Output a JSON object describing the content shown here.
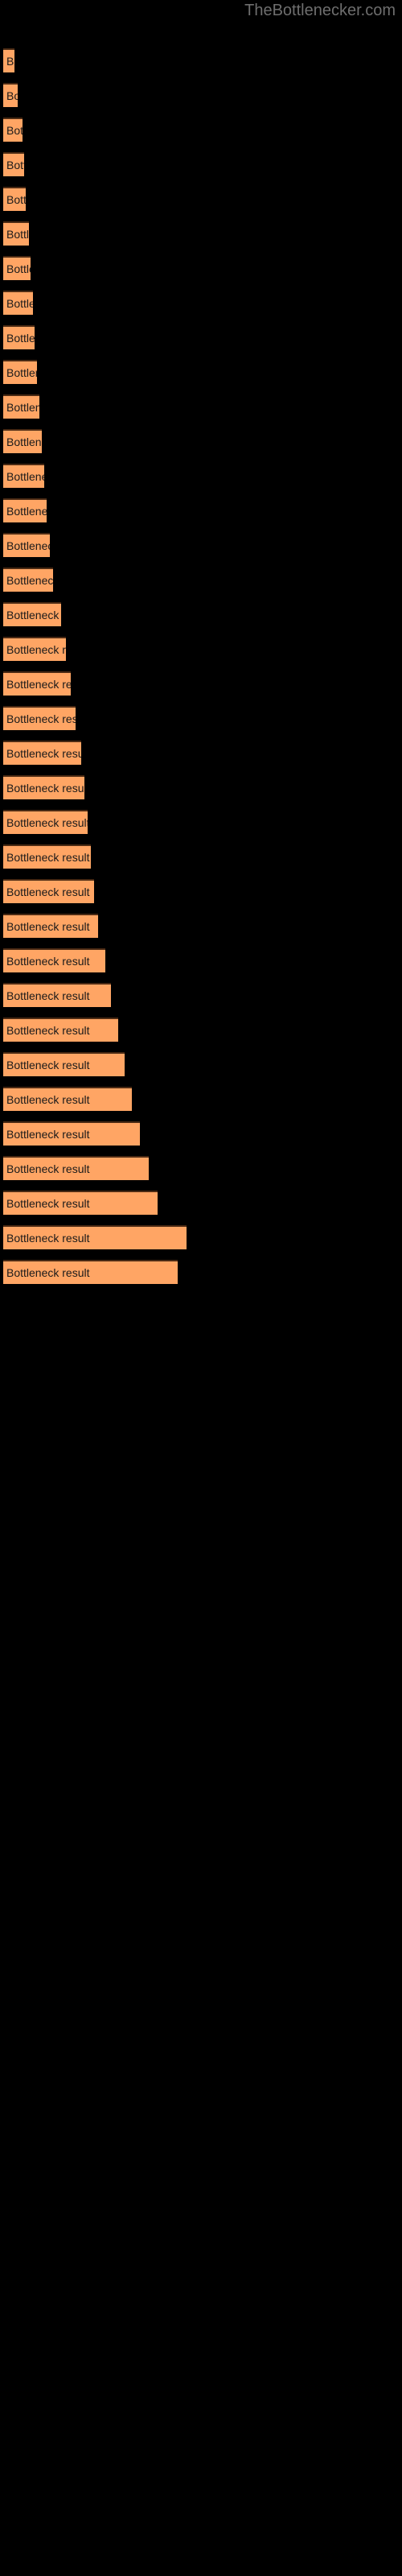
{
  "watermark": {
    "text": "TheBottlenecker.com",
    "color": "#6e6e6e"
  },
  "colors": {
    "background": "#000000",
    "bar_fill": "#ffa564",
    "bar_border_top": "#4a2a14",
    "label_text": "#1a1a1a",
    "watermark_text": "#6e6e6e"
  },
  "chart_data": {
    "type": "bar",
    "orientation": "horizontal",
    "title": "",
    "subtitle": "",
    "xlabel": "",
    "ylabel": "",
    "grid": false,
    "legend": null,
    "axis_visible": false,
    "tick_labels": [],
    "xlim": [
      0,
      228
    ],
    "bar_label_text": "Bottleneck result",
    "categories": [
      "Bottleneck result",
      "Bottleneck result",
      "Bottleneck result",
      "Bottleneck result",
      "Bottleneck result",
      "Bottleneck result",
      "Bottleneck result",
      "Bottleneck result",
      "Bottleneck result",
      "Bottleneck result",
      "Bottleneck result",
      "Bottleneck result",
      "Bottleneck result",
      "Bottleneck result",
      "Bottleneck result",
      "Bottleneck result",
      "Bottleneck result",
      "Bottleneck result",
      "Bottleneck result",
      "Bottleneck result",
      "Bottleneck result",
      "Bottleneck result",
      "Bottleneck result",
      "Bottleneck result",
      "Bottleneck result",
      "Bottleneck result",
      "Bottleneck result",
      "Bottleneck result",
      "Bottleneck result",
      "Bottleneck result",
      "Bottleneck result",
      "Bottleneck result",
      "Bottleneck result",
      "Bottleneck result",
      "Bottleneck result",
      "Bottleneck result"
    ],
    "values": [
      14,
      18,
      24,
      26,
      28,
      32,
      34,
      37,
      39,
      42,
      45,
      48,
      51,
      54,
      58,
      62,
      72,
      78,
      84,
      90,
      97,
      101,
      105,
      109,
      113,
      118,
      127,
      134,
      143,
      151,
      160,
      170,
      181,
      192,
      228,
      217
    ]
  }
}
